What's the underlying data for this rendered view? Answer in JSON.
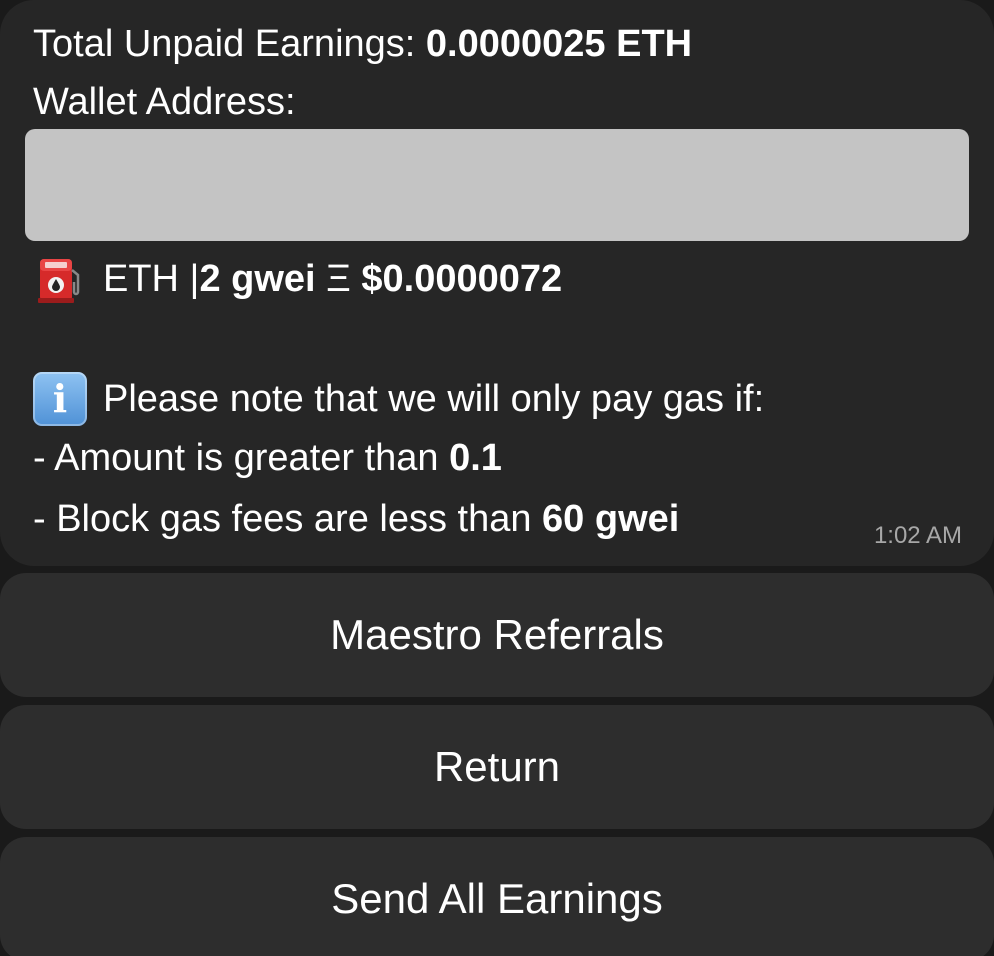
{
  "message": {
    "earnings_label": "Total Unpaid Earnings: ",
    "earnings_value": "0.0000025 ETH",
    "wallet_label": "Wallet Address:",
    "gas_chain": "ETH | ",
    "gas_price": "2 gwei",
    "gas_symbol": " Ξ ",
    "gas_usd": "$0.0000072",
    "note_text": "Please note that we will only pay gas if:",
    "condition_1_text": "- Amount is greater than ",
    "condition_1_value": "0.1",
    "condition_2_text": "- Block gas fees are less than ",
    "condition_2_value": "60 gwei",
    "timestamp": "1:02 AM"
  },
  "icons": {
    "gas": "fuel-pump-icon",
    "info": "information-icon"
  },
  "keyboard": {
    "buttons": [
      {
        "label": "Maestro Referrals"
      },
      {
        "label": "Return"
      },
      {
        "label": "Send All Earnings"
      }
    ]
  },
  "colors": {
    "background": "#1a1a1a",
    "bubble": "#262626",
    "button": "#2d2d2d",
    "redacted": "#c4c4c4",
    "timestamp": "#a7a7a7"
  }
}
